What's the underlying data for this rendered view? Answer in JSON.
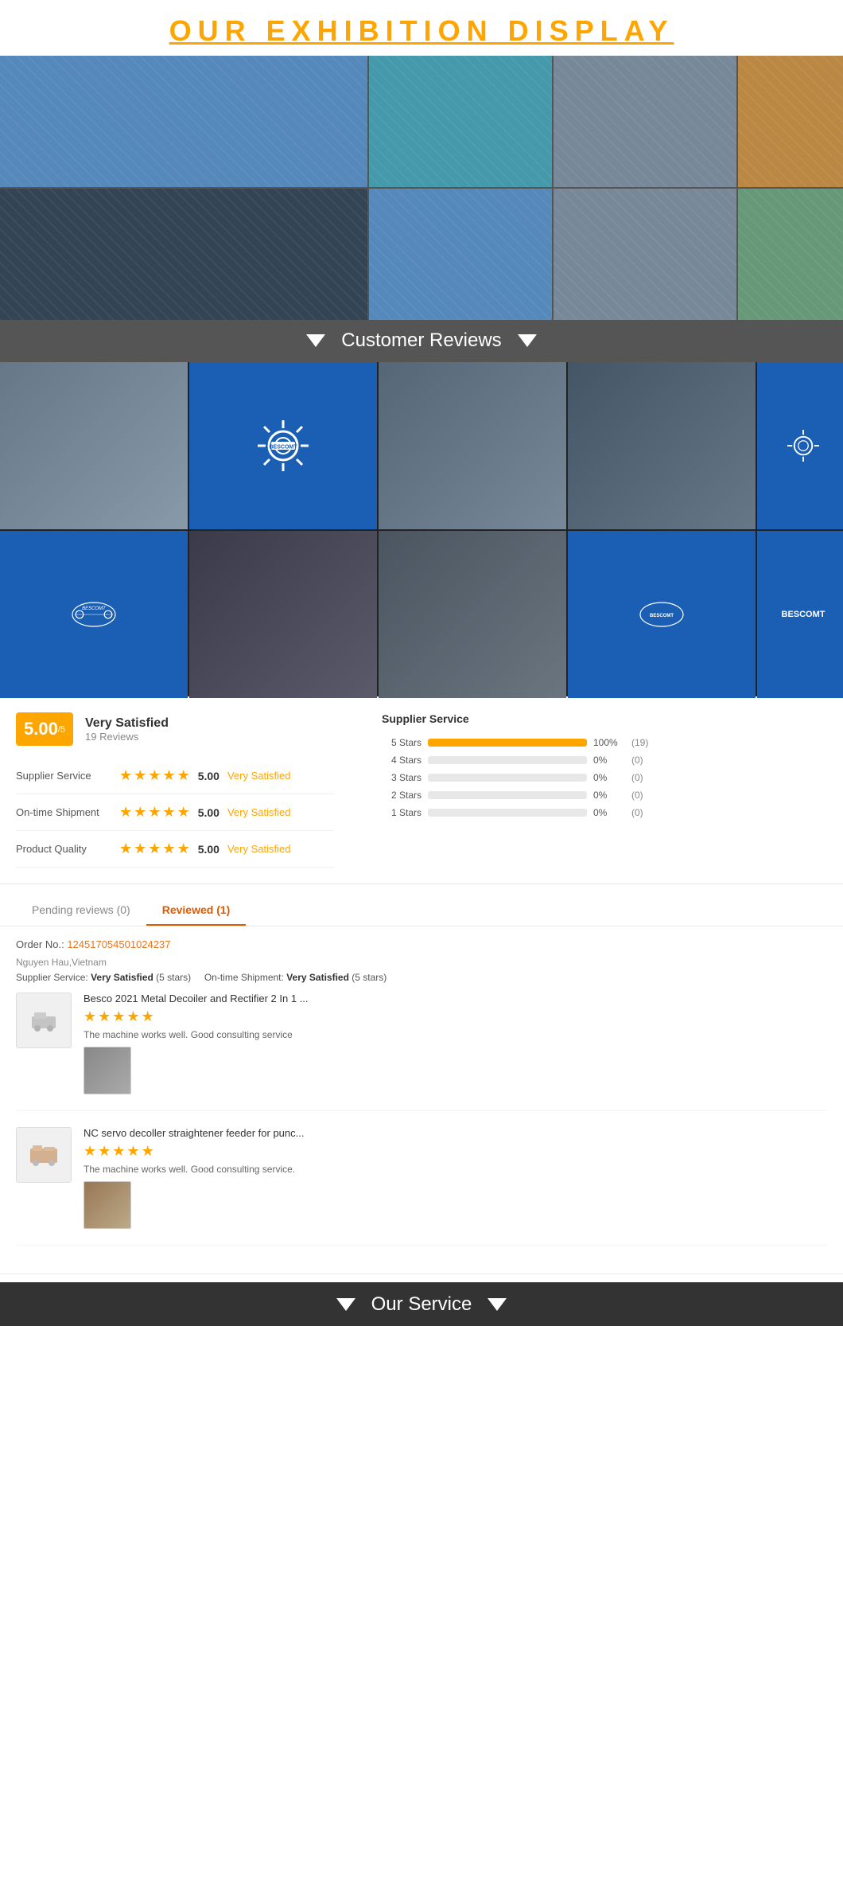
{
  "exhibition": {
    "title": "OUR   EXHIBITION   DISPLAY"
  },
  "reviews_banner": {
    "title": "Customer Reviews"
  },
  "score": {
    "value": "5.00",
    "sub": "/5",
    "label": "Very Satisfied",
    "count": "19 Reviews"
  },
  "categories": [
    {
      "label": "Supplier Service",
      "score": "5.00",
      "status": "Very Satisfied",
      "stars": 5
    },
    {
      "label": "On-time Shipment",
      "score": "5.00",
      "status": "Very Satisfied",
      "stars": 5
    },
    {
      "label": "Product Quality",
      "score": "5.00",
      "status": "Very Satisfied",
      "stars": 5
    }
  ],
  "chart_title": "Supplier Service",
  "bars": [
    {
      "label": "5 Stars",
      "pct": 100,
      "pct_text": "100%",
      "count": "(19)"
    },
    {
      "label": "4 Stars",
      "pct": 0,
      "pct_text": "0%",
      "count": "(0)"
    },
    {
      "label": "3 Stars",
      "pct": 0,
      "pct_text": "0%",
      "count": "(0)"
    },
    {
      "label": "2 Stars",
      "pct": 0,
      "pct_text": "0%",
      "count": "(0)"
    },
    {
      "label": "1 Stars",
      "pct": 0,
      "pct_text": "0%",
      "count": "(0)"
    }
  ],
  "tabs": [
    {
      "label": "Pending reviews (0)",
      "active": false
    },
    {
      "label": "Reviewed (1)",
      "active": true
    }
  ],
  "order": {
    "label": "Order No.:",
    "number": "124517054501024237",
    "reviewer": "Nguyen Hau,Vietnam",
    "supplier_service_label": "Supplier Service:",
    "supplier_service_value": "Very Satisfied",
    "supplier_service_stars": "(5 stars)",
    "ontime_label": "On-time Shipment:",
    "ontime_value": "Very Satisfied",
    "ontime_stars": "(5 stars)"
  },
  "products": [
    {
      "title": "Besco 2021 Metal Decoiler and Rectifier 2 In 1 ...",
      "stars": 5,
      "comment": "The machine works well. Good consulting service"
    },
    {
      "title": "NC servo decoller straightener feeder for punc...",
      "stars": 5,
      "comment": "The machine works well. Good consulting service."
    }
  ],
  "service_banner": {
    "title": "Our Service"
  },
  "bescomt": {
    "name": "BESCOMT"
  }
}
